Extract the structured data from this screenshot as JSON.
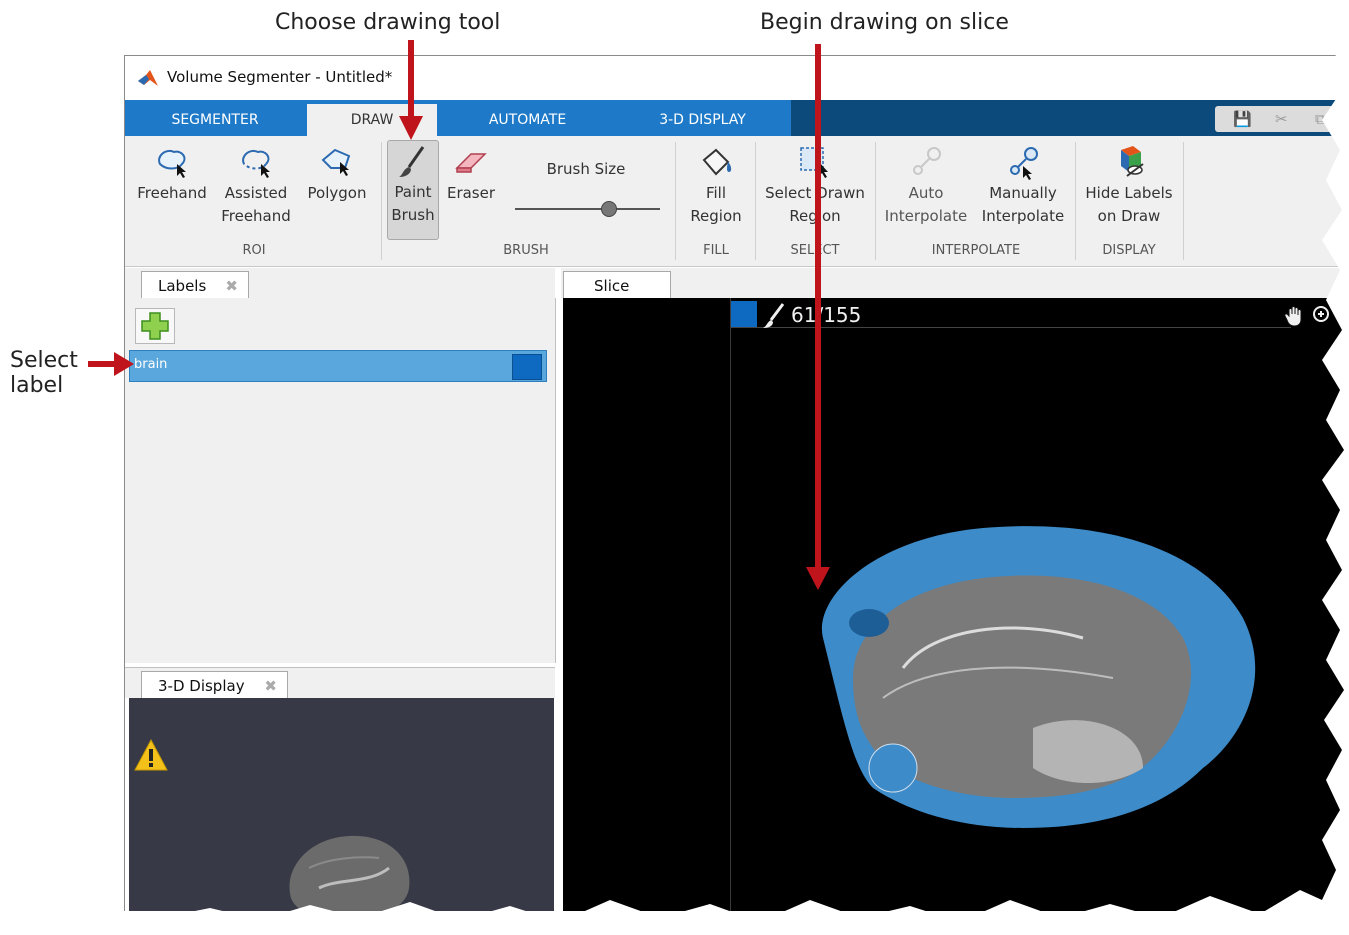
{
  "annotations": {
    "choose_tool": "Choose drawing tool",
    "begin_drawing": "Begin drawing on slice",
    "select_label_line1": "Select",
    "select_label_line2": "label"
  },
  "window": {
    "title": "Volume Segmenter - Untitled*"
  },
  "tabs": [
    {
      "label": "SEGMENTER"
    },
    {
      "label": "DRAW"
    },
    {
      "label": "AUTOMATE"
    },
    {
      "label": "3-D DISPLAY"
    }
  ],
  "ribbon": {
    "roi": {
      "group": "ROI",
      "freehand": "Freehand",
      "assisted_line1": "Assisted",
      "assisted_line2": "Freehand",
      "polygon": "Polygon"
    },
    "brush": {
      "group": "BRUSH",
      "paint_line1": "Paint",
      "paint_line2": "Brush",
      "eraser": "Eraser",
      "brush_size_label": "Brush Size",
      "brush_size_value": 0.65
    },
    "fill": {
      "group": "FILL",
      "line1": "Fill",
      "line2": "Region"
    },
    "select": {
      "group": "SELECT",
      "line1": "Select Drawn",
      "line2": "Region"
    },
    "interpolate": {
      "group": "INTERPOLATE",
      "auto_line1": "Auto",
      "auto_line2": "Interpolate",
      "manual_line1": "Manually",
      "manual_line2": "Interpolate"
    },
    "display": {
      "group": "DISPLAY",
      "line1": "Hide Labels",
      "line2": "on Draw"
    }
  },
  "labels_panel": {
    "tab": "Labels",
    "items": [
      {
        "name": "brain",
        "color": "#0d6ac0"
      }
    ]
  },
  "display_panel": {
    "tab": "3-D Display"
  },
  "slice_panel": {
    "tab": "Slice",
    "slice_number": "61/155"
  },
  "colors": {
    "tab_strip": "#1e7ac8",
    "ribbon": "#f0f0f0",
    "label_color": "#0d6ac0",
    "annotation_arrow": "#c0141c"
  }
}
